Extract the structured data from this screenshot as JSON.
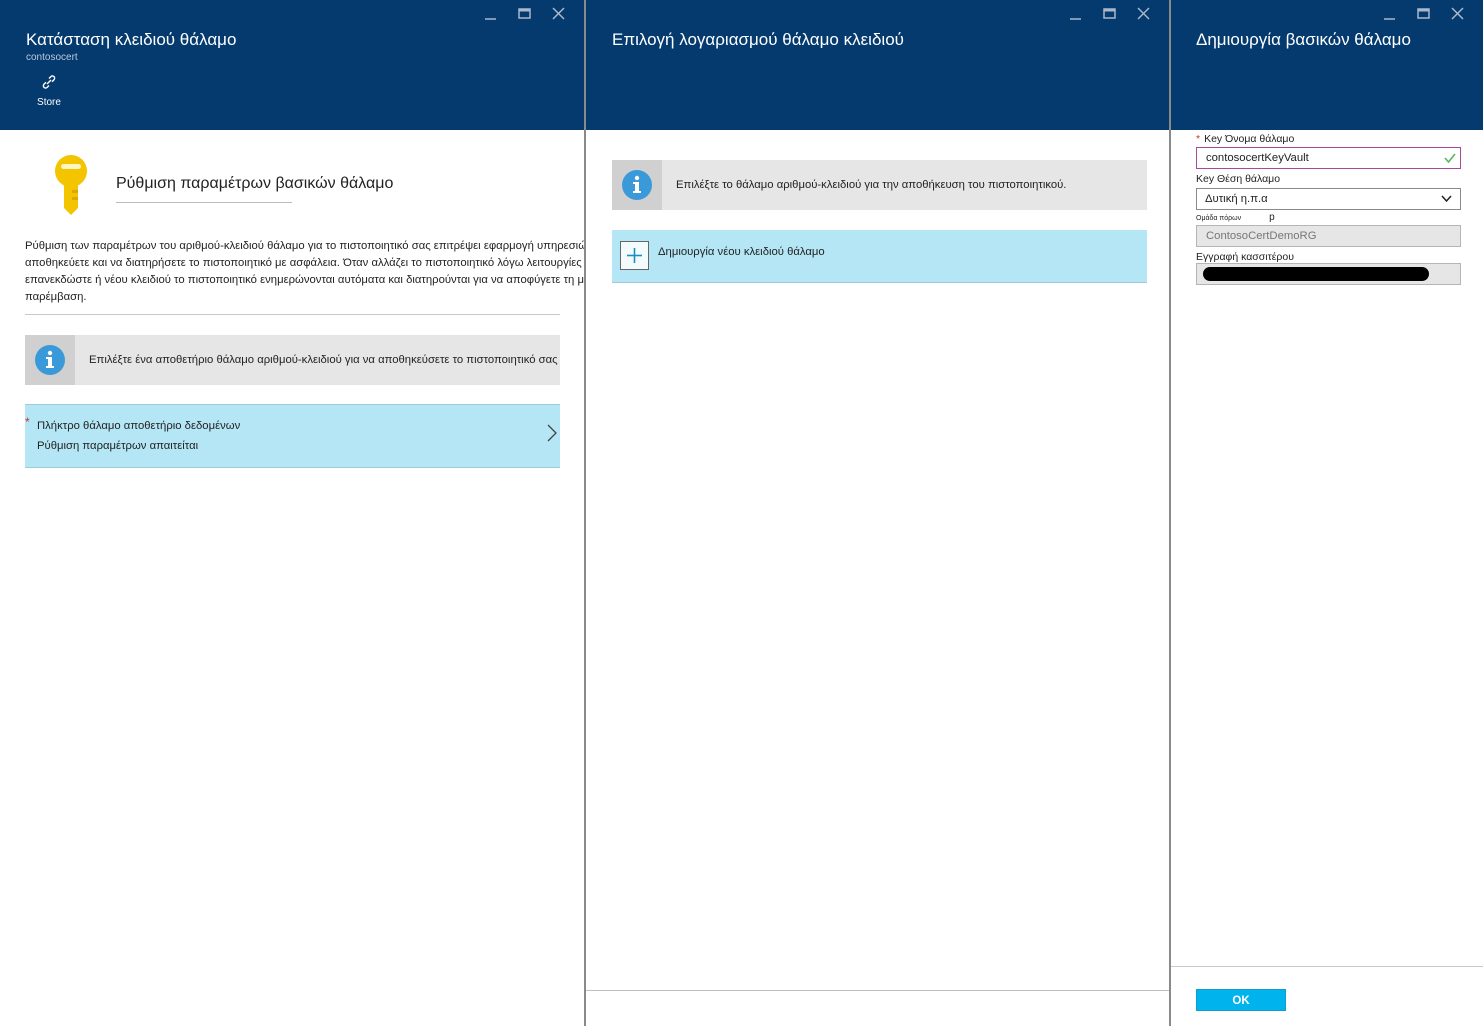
{
  "blade1": {
    "title": "Κατάσταση κλειδιού θάλαμο",
    "subtitle": "contosocert",
    "store_label": "Store",
    "essentials_title": "Ρύθμιση παραμέτρων βασικών θάλαμο",
    "description": "Ρύθμιση των παραμέτρων του αριθμού-κλειδιού θάλαμο για το πιστοποιητικό σας επιτρέψει εφαρμογή υπηρεσιών να αποθηκεύετε και να διατηρήσετε το πιστοποιητικό με ασφάλεια. Όταν αλλάζει το πιστοποιητικό λόγω λειτουργίες επανεκδώστε ή νέου κλειδιού το πιστοποιητικό ενημερώνονται αυτόματα και διατηρούνται για να αποφύγετε τη μη αυτόματη παρέμβαση.",
    "info_text": "Επιλέξτε ένα αποθετήριο θάλαμο αριθμού-κλειδιού για να αποθηκεύσετε το πιστοποιητικό σας",
    "keyvault_row": {
      "required_mark": "*",
      "label": "Πλήκτρο θάλαμο αποθετήριο δεδομένων",
      "status": "Ρύθμιση παραμέτρων απαιτείται"
    }
  },
  "blade2": {
    "title": "Επιλογή λογαριασμού θάλαμο κλειδιού",
    "info_text": "Επιλέξτε το θάλαμο αριθμού-κλειδιού για την αποθήκευση του πιστοποιητικού.",
    "create_new_label": "Δημιουργία νέου κλειδιού θάλαμο"
  },
  "blade3": {
    "title": "Δημιουργία βασικών θάλαμο",
    "name_label": "Key Όνομα θάλαμο",
    "name_required": "*",
    "name_value": "contosocertKeyVault",
    "location_label": "Key Θέση θάλαμο",
    "location_value": "Δυτική η.π.α",
    "rg_label": "Ομάδα πόρων",
    "rg_label_suffix": "p",
    "rg_value": "ContosoCertDemoRG",
    "subscription_label": "Εγγραφή κασσιτέρου",
    "ok_label": "OK"
  },
  "colors": {
    "header": "#053a6e",
    "highlight_row": "#b4e6f5",
    "info_bar": "#e6e6e6",
    "ok_button": "#00b3ec",
    "key_icon": "#f5c400",
    "info_icon": "#3a9ad9"
  }
}
